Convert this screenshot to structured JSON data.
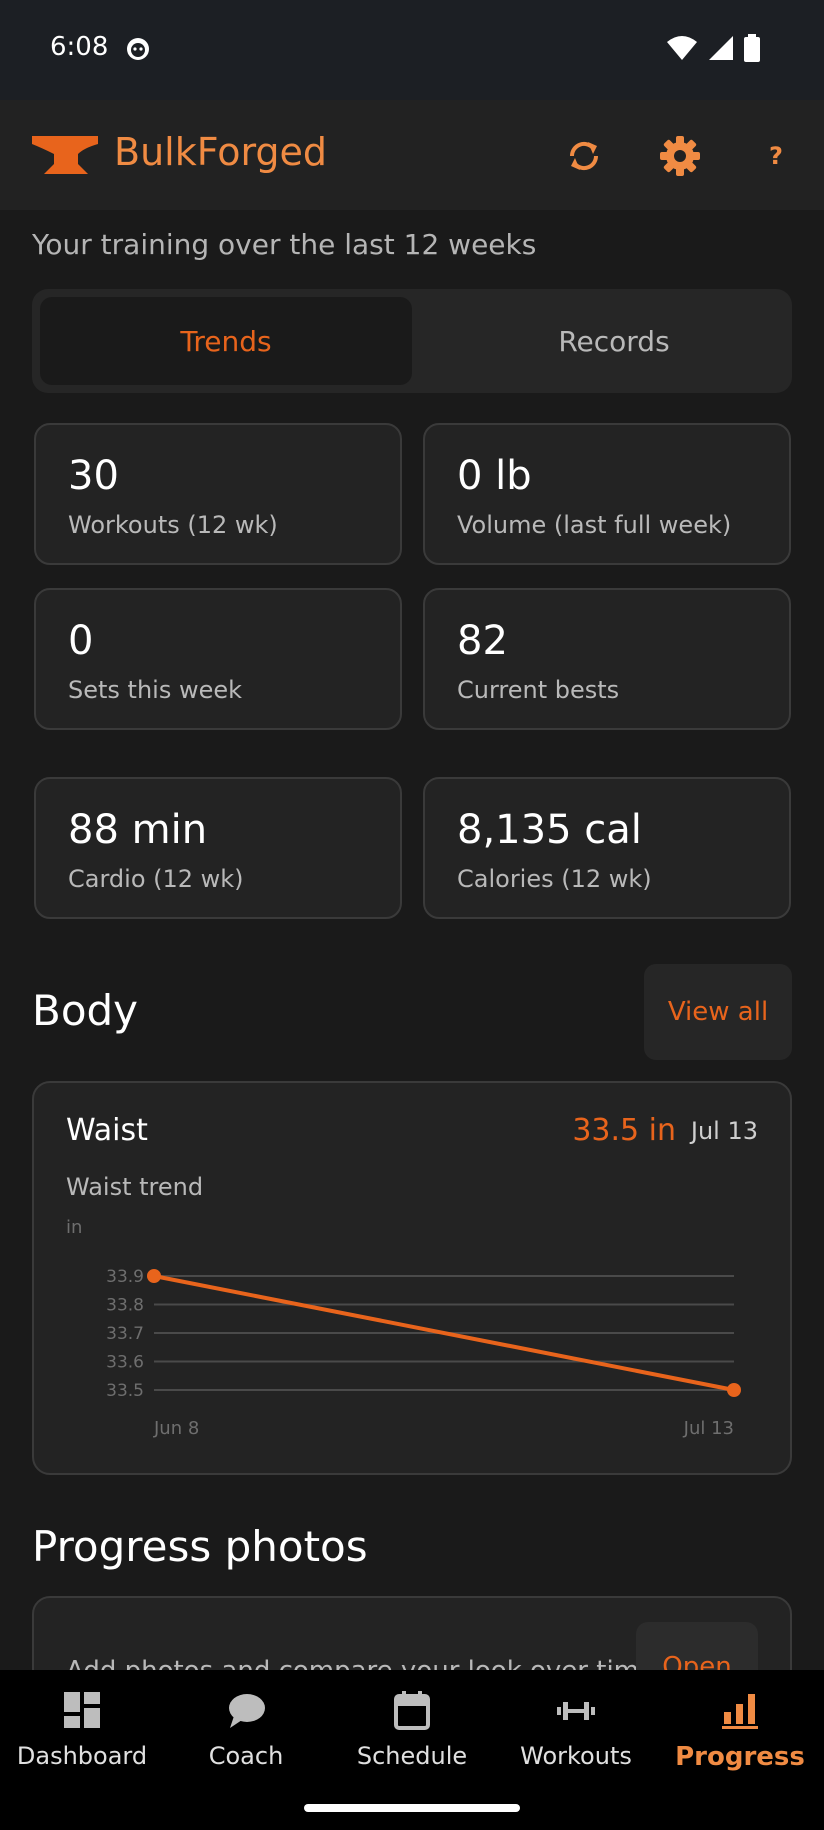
{
  "status_bar": {
    "time": "6:08"
  },
  "app_bar": {
    "title": "BulkForged",
    "help_label": "?"
  },
  "subtitle": "Your training over the last 12 weeks",
  "segments": {
    "trends": "Trends",
    "records": "Records"
  },
  "stats": [
    {
      "value": "30",
      "label": "Workouts (12 wk)"
    },
    {
      "value": "0 lb",
      "label": "Volume (last full week)"
    },
    {
      "value": "0",
      "label": "Sets this week"
    },
    {
      "value": "82",
      "label": "Current bests"
    },
    {
      "value": "88 min",
      "label": "Cardio (12 wk)"
    },
    {
      "value": "8,135 cal",
      "label": "Calories (12 wk)"
    }
  ],
  "body_section": {
    "title": "Body",
    "view_all": "View all",
    "measurement": {
      "name": "Waist",
      "value": "33.5 in",
      "date": "Jul 13",
      "trend_label": "Waist trend",
      "unit": "in"
    }
  },
  "chart_data": {
    "type": "line",
    "ylabel": "in",
    "x": [
      "Jun 8",
      "Jul 13"
    ],
    "series": [
      {
        "values": [
          33.9,
          33.5
        ]
      }
    ],
    "y_ticks": [
      "33.9",
      "33.8",
      "33.7",
      "33.6",
      "33.5"
    ],
    "ylim": [
      33.5,
      33.9
    ],
    "grid": true,
    "color": "#e8641c"
  },
  "photos_section": {
    "title": "Progress photos",
    "text": "Add photos and compare your look over time",
    "open": "Open"
  },
  "nav": {
    "items": [
      {
        "label": "Dashboard",
        "icon": "dashboard-icon"
      },
      {
        "label": "Coach",
        "icon": "chat-bubble-icon"
      },
      {
        "label": "Schedule",
        "icon": "calendar-icon"
      },
      {
        "label": "Workouts",
        "icon": "dumbbell-icon"
      },
      {
        "label": "Progress",
        "icon": "bar-chart-icon"
      }
    ],
    "active": "Progress"
  },
  "colors": {
    "accent": "#e8641c",
    "accent_light": "#f08b43",
    "background": "#1a1a1a",
    "card": "#232323"
  }
}
